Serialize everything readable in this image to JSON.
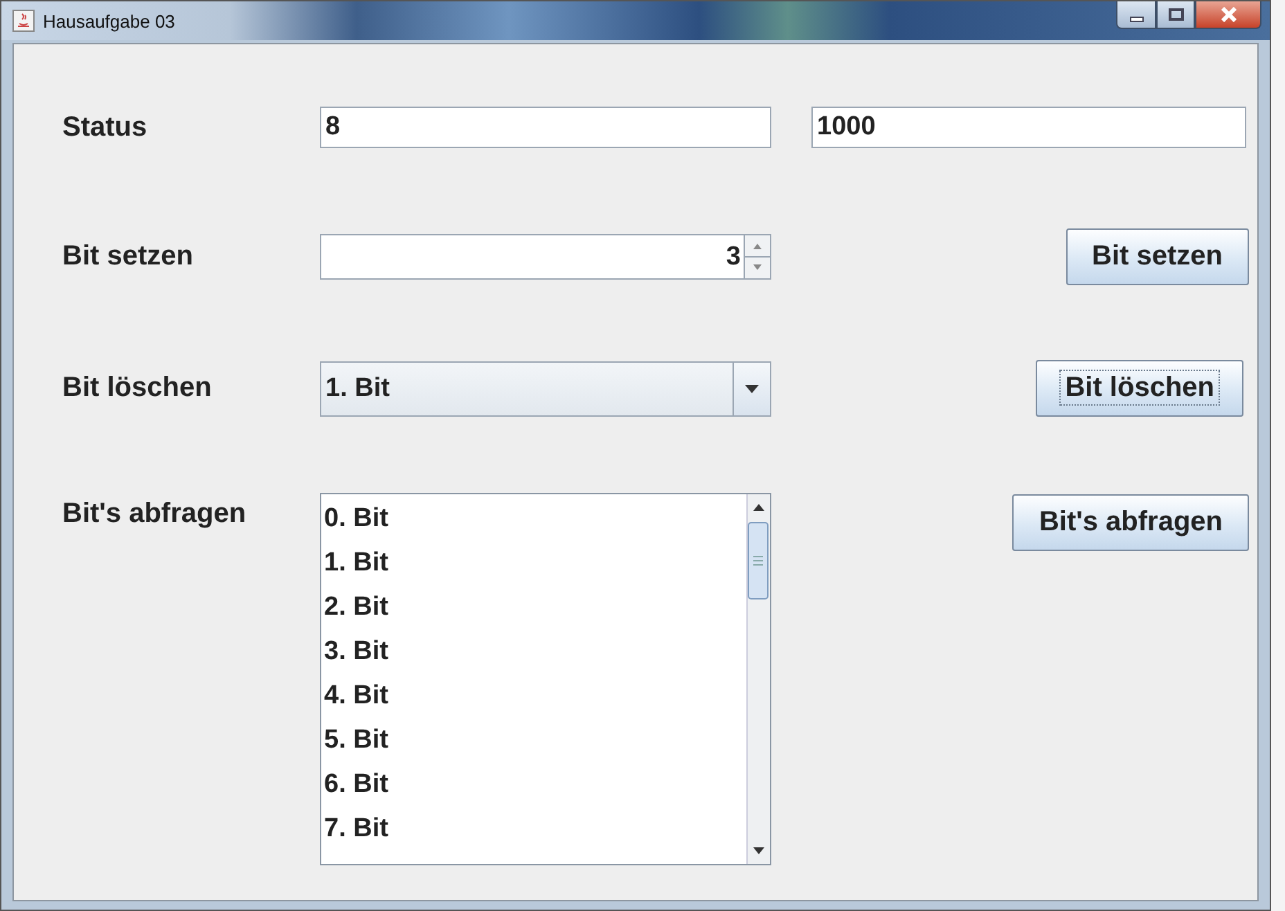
{
  "window": {
    "title": "Hausaufgabe 03"
  },
  "status": {
    "label": "Status",
    "decimal_value": "8",
    "binary_value": "1000"
  },
  "set_bit": {
    "label": "Bit setzen",
    "value": "3",
    "button": {
      "label": "Bit setzen",
      "focused": false
    }
  },
  "clear_bit": {
    "label": "Bit löschen",
    "selection": "1. Bit",
    "button": {
      "label": "Bit löschen",
      "focused": true
    }
  },
  "query_bits": {
    "label": "Bit's abfragen",
    "button": {
      "label": "Bit's abfragen",
      "focused": false
    },
    "items": [
      {
        "label": "0. Bit",
        "selected": false
      },
      {
        "label": "1. Bit",
        "selected": false
      },
      {
        "label": "2. Bit",
        "selected": false
      },
      {
        "label": "3. Bit",
        "selected": false
      },
      {
        "label": "4. Bit",
        "selected": false
      },
      {
        "label": "5. Bit",
        "selected": false
      },
      {
        "label": "6. Bit",
        "selected": false
      },
      {
        "label": "7. Bit",
        "selected": false
      }
    ]
  }
}
